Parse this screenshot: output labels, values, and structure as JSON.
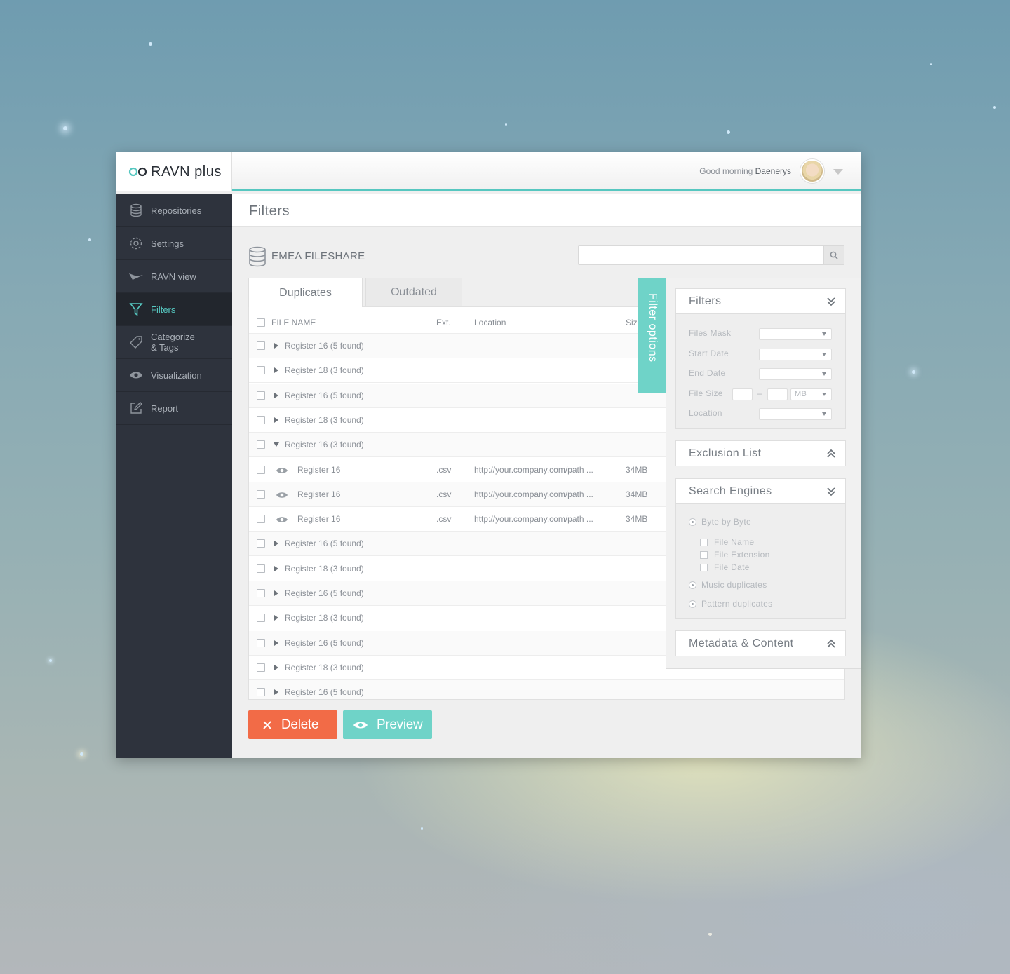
{
  "app": {
    "name": "RAVN plus"
  },
  "header": {
    "greeting": "Good morning",
    "user_name": "Daenerys"
  },
  "sidebar": {
    "items": [
      {
        "label": "Repositories",
        "icon": "database-icon",
        "active": false
      },
      {
        "label": "Settings",
        "icon": "gear-icon",
        "active": false
      },
      {
        "label": "RAVN view",
        "icon": "bird-icon",
        "active": false
      },
      {
        "label": "Filters",
        "icon": "filter-icon",
        "active": true
      },
      {
        "label": "Categorize & Tags",
        "label_line1": "Categorize",
        "label_line2": "& Tags",
        "icon": "tag-icon",
        "active": false
      },
      {
        "label": "Visualization",
        "icon": "eye-icon",
        "active": false
      },
      {
        "label": "Report",
        "icon": "edit-icon",
        "active": false
      }
    ]
  },
  "page": {
    "title": "Filters",
    "repository": "EMEA FILESHARE",
    "search_placeholder": ""
  },
  "tabs": [
    {
      "label": "Duplicates",
      "active": true
    },
    {
      "label": "Outdated",
      "active": false
    }
  ],
  "table": {
    "columns": {
      "file_name": "FILE NAME",
      "ext": "Ext.",
      "location": "Location",
      "size": "Siz"
    },
    "rows": [
      {
        "type": "group",
        "expanded": false,
        "name": "Register 16 (5 found)"
      },
      {
        "type": "group",
        "expanded": false,
        "name": "Register 18 (3 found)"
      },
      {
        "type": "group",
        "expanded": false,
        "name": "Register 16 (5 found)"
      },
      {
        "type": "group",
        "expanded": false,
        "name": "Register 18 (3 found)"
      },
      {
        "type": "group",
        "expanded": true,
        "name": "Register 16 (3 found)"
      },
      {
        "type": "file",
        "name": "Register 16",
        "ext": ".csv",
        "location": "http://your.company.com/path ...",
        "size": "34MB"
      },
      {
        "type": "file",
        "name": "Register 16",
        "ext": ".csv",
        "location": "http://your.company.com/path ...",
        "size": "34MB"
      },
      {
        "type": "file",
        "name": "Register 16",
        "ext": ".csv",
        "location": "http://your.company.com/path ...",
        "size": "34MB"
      },
      {
        "type": "group",
        "expanded": false,
        "name": "Register 16 (5 found)"
      },
      {
        "type": "group",
        "expanded": false,
        "name": "Register 18 (3 found)"
      },
      {
        "type": "group",
        "expanded": false,
        "name": "Register 16 (5 found)"
      },
      {
        "type": "group",
        "expanded": false,
        "name": "Register 18 (3 found)"
      },
      {
        "type": "group",
        "expanded": false,
        "name": "Register 16 (5 found)"
      },
      {
        "type": "group",
        "expanded": false,
        "name": "Register 18 (3 found)"
      },
      {
        "type": "group",
        "expanded": false,
        "name": "Register 16 (5 found)"
      }
    ]
  },
  "filter_tab": {
    "label": "Filter options"
  },
  "filter_panel": {
    "filters": {
      "title": "Filters",
      "files_mask": "Files Mask",
      "start_date": "Start Date",
      "end_date": "End Date",
      "file_size": "File Size",
      "file_size_sep": "–",
      "file_size_unit": "MB",
      "location": "Location"
    },
    "exclusion_list": {
      "title": "Exclusion List"
    },
    "search_engines": {
      "title": "Search Engines",
      "byte_by_byte": "Byte by Byte",
      "file_name": "File Name",
      "file_extension": "File Extension",
      "file_date": "File Date",
      "music_duplicates": "Music duplicates",
      "pattern_duplicates": "Pattern duplicates"
    },
    "metadata": {
      "title": "Metadata & Content"
    }
  },
  "actions": {
    "delete": "Delete",
    "preview": "Preview"
  },
  "colors": {
    "accent": "#56c7c0",
    "delete": "#f26b47",
    "preview": "#6fd3c8",
    "sidebar": "#2e333d"
  }
}
